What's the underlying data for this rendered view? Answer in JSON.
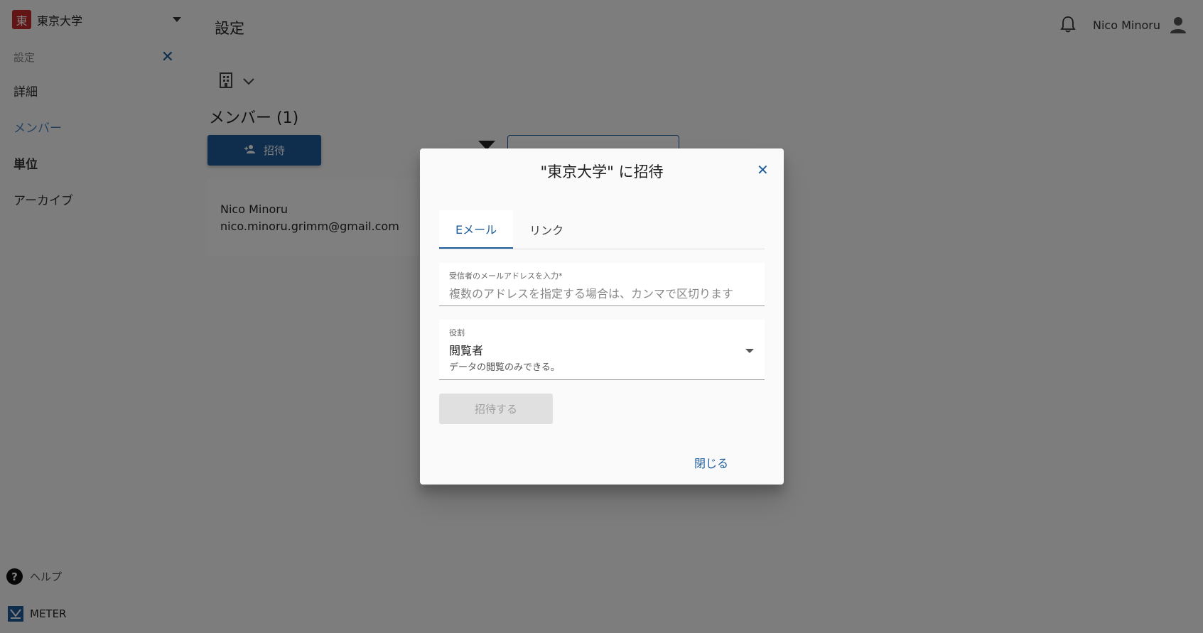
{
  "sidebar": {
    "org_logo": "東",
    "org_name": "東京大学",
    "header_label": "設定",
    "items": [
      {
        "label": "詳細"
      },
      {
        "label": "メンバー"
      },
      {
        "label": "単位"
      },
      {
        "label": "アーカイブ"
      }
    ],
    "help_label": "ヘルプ",
    "brand_label": "METER"
  },
  "topbar": {
    "title": "設定",
    "user_name": "Nico Minoru"
  },
  "members": {
    "title": "メンバー (1)",
    "invite_label": "招待",
    "list": [
      {
        "name": "Nico Minoru",
        "email": "nico.minoru.grimm@gmail.com"
      }
    ]
  },
  "dialog": {
    "title": "\"東京大学\" に招待",
    "tabs": [
      {
        "label": "Eメール"
      },
      {
        "label": "リンク"
      }
    ],
    "email_field": {
      "label": "受信者のメールアドレスを入力*",
      "placeholder": "複数のアドレスを指定する場合は、カンマで区切ります",
      "value": ""
    },
    "role_field": {
      "label": "役割",
      "value": "閲覧者",
      "description": "データの閲覧のみできる。"
    },
    "submit_label": "招待する",
    "close_label": "閉じる"
  },
  "colors": {
    "accent": "#1e5d9c",
    "org_logo_bg": "#c62828",
    "overlay": "rgba(0,0,0,0.5)"
  }
}
